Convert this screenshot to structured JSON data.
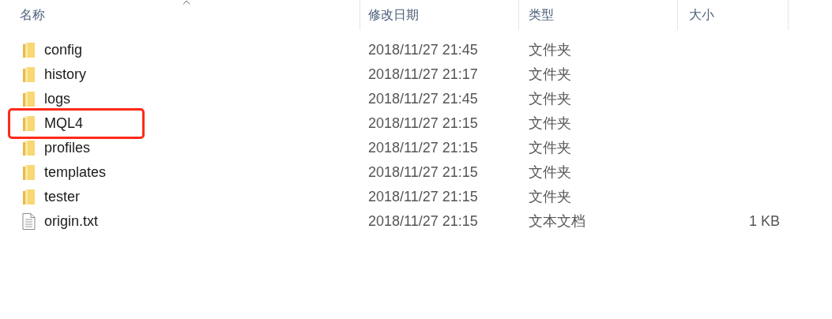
{
  "columns": [
    {
      "label": "名称",
      "sorted": true
    },
    {
      "label": "修改日期",
      "sorted": false
    },
    {
      "label": "类型",
      "sorted": false
    },
    {
      "label": "大小",
      "sorted": false
    }
  ],
  "rows": [
    {
      "kind": "folder",
      "name": "config",
      "date": "2018/11/27 21:45",
      "type": "文件夹",
      "annotated": false
    },
    {
      "kind": "folder",
      "name": "history",
      "date": "2018/11/27 21:17",
      "type": "文件夹",
      "annotated": false
    },
    {
      "kind": "folder",
      "name": "logs",
      "date": "2018/11/27 21:45",
      "type": "文件夹",
      "annotated": false
    },
    {
      "kind": "folder",
      "name": "MQL4",
      "date": "2018/11/27 21:15",
      "type": "文件夹",
      "annotated": true
    },
    {
      "kind": "folder",
      "name": "profiles",
      "date": "2018/11/27 21:15",
      "type": "文件夹",
      "annotated": false
    },
    {
      "kind": "folder",
      "name": "templates",
      "date": "2018/11/27 21:15",
      "type": "文件夹",
      "annotated": false
    },
    {
      "kind": "folder",
      "name": "tester",
      "date": "2018/11/27 21:15",
      "type": "文件夹",
      "annotated": false
    },
    {
      "kind": "file",
      "name": "origin.txt",
      "date": "2018/11/27 21:15",
      "type": "文本文档",
      "size": "1 KB",
      "annotated": false
    }
  ]
}
